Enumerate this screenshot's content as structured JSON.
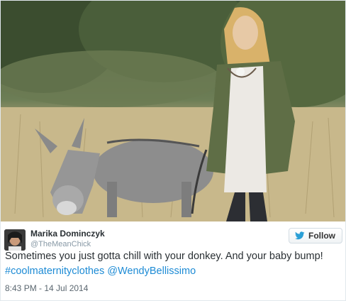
{
  "photo": {
    "alt": "",
    "colors": {
      "sky_trees": "#5c6e49",
      "grass": "#c9b98d",
      "donkey": "#8f8f8f",
      "jacket": "#5f6e46"
    }
  },
  "author": {
    "name": "Marika Dominczyk",
    "handle": "@TheMeanChick"
  },
  "follow_button": {
    "label": "Follow",
    "icon": "twitter-bird-icon"
  },
  "tweet": {
    "text_plain": "Sometimes you just gotta chill with your donkey. And your baby bump! ",
    "hashtag": "#coolmaternityclothes",
    "mention": "@WendyBellissimo",
    "timestamp": "8:43 PM - 14 Jul 2014"
  },
  "colors": {
    "link": "#1d8bd5",
    "text": "#292f33",
    "muted": "#8899a6"
  }
}
